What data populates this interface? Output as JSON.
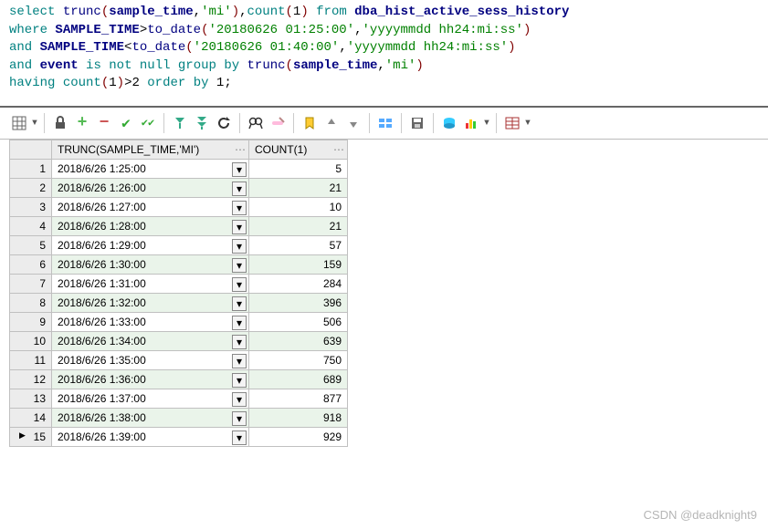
{
  "sql": {
    "select_kw": "select",
    "trunc_fn": "trunc",
    "sample_time": "sample_time",
    "mi_literal": "'mi'",
    "count_kw": "count",
    "one": "1",
    "from_kw": "from",
    "table": "dba_hist_active_sess_history",
    "where_kw": "where",
    "SAMPLE_TIME_upper": "SAMPLE_TIME",
    "gt": ">",
    "lt": "<",
    "to_date_fn": "to_date",
    "date1": "'20180626 01:25:00'",
    "date2": "'20180626 01:40:00'",
    "fmt": "'yyyymmdd hh24:mi:ss'",
    "and_kw": "and",
    "event": "event",
    "is_kw": "is",
    "not_kw": "not",
    "null_kw": "null",
    "group_by_kw": "group by",
    "having_kw": "having",
    "gt2": ">2",
    "order_by_kw": "order by",
    "semicolon": ";"
  },
  "toolbar": {
    "icons": [
      "grid-options",
      "lock",
      "add",
      "delete",
      "commit",
      "commit-all",
      "fetch-next",
      "fetch-all",
      "refresh",
      "find",
      "clear-filter",
      "bookmark",
      "bookmark-up",
      "bookmark-down",
      "compare",
      "save",
      "single-record",
      "chart-view",
      "table-view"
    ]
  },
  "headers": {
    "col1": "TRUNC(SAMPLE_TIME,'MI')",
    "col2": "COUNT(1)"
  },
  "rows": [
    {
      "n": 1,
      "time": "2018/6/26 1:25:00",
      "count": 5
    },
    {
      "n": 2,
      "time": "2018/6/26 1:26:00",
      "count": 21
    },
    {
      "n": 3,
      "time": "2018/6/26 1:27:00",
      "count": 10
    },
    {
      "n": 4,
      "time": "2018/6/26 1:28:00",
      "count": 21
    },
    {
      "n": 5,
      "time": "2018/6/26 1:29:00",
      "count": 57
    },
    {
      "n": 6,
      "time": "2018/6/26 1:30:00",
      "count": 159
    },
    {
      "n": 7,
      "time": "2018/6/26 1:31:00",
      "count": 284
    },
    {
      "n": 8,
      "time": "2018/6/26 1:32:00",
      "count": 396
    },
    {
      "n": 9,
      "time": "2018/6/26 1:33:00",
      "count": 506
    },
    {
      "n": 10,
      "time": "2018/6/26 1:34:00",
      "count": 639
    },
    {
      "n": 11,
      "time": "2018/6/26 1:35:00",
      "count": 750
    },
    {
      "n": 12,
      "time": "2018/6/26 1:36:00",
      "count": 689
    },
    {
      "n": 13,
      "time": "2018/6/26 1:37:00",
      "count": 877
    },
    {
      "n": 14,
      "time": "2018/6/26 1:38:00",
      "count": 918
    },
    {
      "n": 15,
      "time": "2018/6/26 1:39:00",
      "count": 929
    }
  ],
  "watermark": "CSDN @deadknight9"
}
